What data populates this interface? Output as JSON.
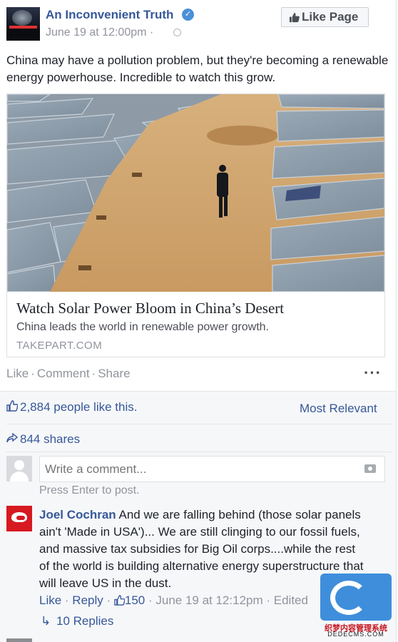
{
  "header": {
    "page_name": "An Inconvenient Truth",
    "timestamp": "June 19 at 12:00pm · ",
    "like_page_label": "Like Page"
  },
  "post": {
    "message": "China may have a pollution problem, but they're becoming a renewable energy powerhouse. Incredible to watch this grow."
  },
  "link_card": {
    "title": "Watch Solar Power Bloom in China’s Desert",
    "description": "China leads the world in renewable power growth.",
    "domain": "TAKEPART.COM"
  },
  "actions": {
    "like": "Like",
    "comment": "Comment",
    "share": "Share",
    "more": "···"
  },
  "ufi": {
    "likes_text": "2,884 people like this.",
    "sort_label": "Most Relevant",
    "shares_text": "844 shares",
    "comment_placeholder": "Write a comment...",
    "press_enter": "Press Enter to post."
  },
  "comment": {
    "author": "Joel Cochran",
    "text": "And we are falling behind (those solar panels ain't 'Made in USA')... We are still clinging to our fossil fuels, and massive tax subsidies for Big Oil corps....while the rest of the world is building alternative energy superstructure that will leave US in the dust.",
    "like": "Like",
    "reply": "Reply",
    "reaction_count": "150",
    "time": "June 19 at 12:12pm",
    "edited": "Edited",
    "replies": "10 Replies"
  },
  "watermark": {
    "line1": "织梦内容管理系统",
    "line2": "DEDECMS.COM"
  },
  "colors": {
    "link_blue": "#365899",
    "meta_gray": "#90949c",
    "ufi_bg": "#f6f7f9",
    "verified_blue": "#4a90d9"
  }
}
